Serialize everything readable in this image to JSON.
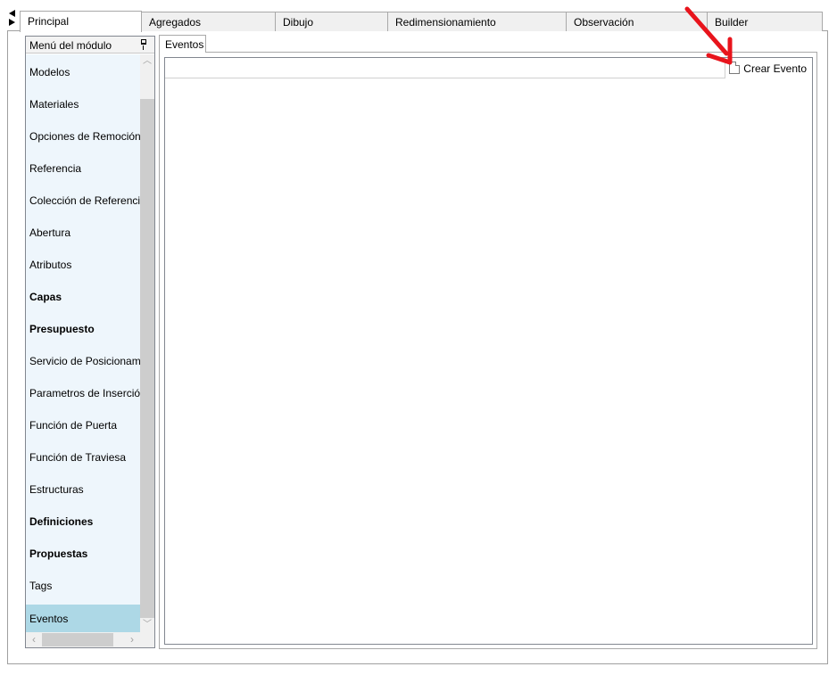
{
  "top_tabs": [
    {
      "label": "Principal"
    },
    {
      "label": "Agregados"
    },
    {
      "label": "Dibujo"
    },
    {
      "label": "Redimensionamiento"
    },
    {
      "label": "Observación"
    },
    {
      "label": "Builder"
    }
  ],
  "module_menu": {
    "header": "Menú del módulo",
    "items": [
      {
        "label": "Modelos"
      },
      {
        "label": "Materiales"
      },
      {
        "label": "Opciones de Remoción"
      },
      {
        "label": "Referencia"
      },
      {
        "label": "Colección de Referencias"
      },
      {
        "label": "Abertura"
      },
      {
        "label": "Atributos"
      },
      {
        "label": "Capas"
      },
      {
        "label": "Presupuesto"
      },
      {
        "label": "Servicio de Posicionamiento"
      },
      {
        "label": "Parametros de Inserción"
      },
      {
        "label": "Función de Puerta"
      },
      {
        "label": "Función de Traviesa"
      },
      {
        "label": "Estructuras"
      },
      {
        "label": "Definiciones"
      },
      {
        "label": "Propuestas"
      },
      {
        "label": "Tags"
      },
      {
        "label": "Eventos"
      }
    ],
    "selected": "Eventos"
  },
  "content": {
    "tab_label": "Eventos",
    "create_button_label": "Crear Evento"
  },
  "colors": {
    "menu_background": "#eef6fc",
    "selected_item": "#add8e6",
    "annotation_arrow": "#e8141c"
  },
  "icons": {
    "collapse": "arrow-left-icon",
    "expand": "arrow-right-icon",
    "pin": "pin-icon",
    "new_document": "new-document-icon"
  }
}
